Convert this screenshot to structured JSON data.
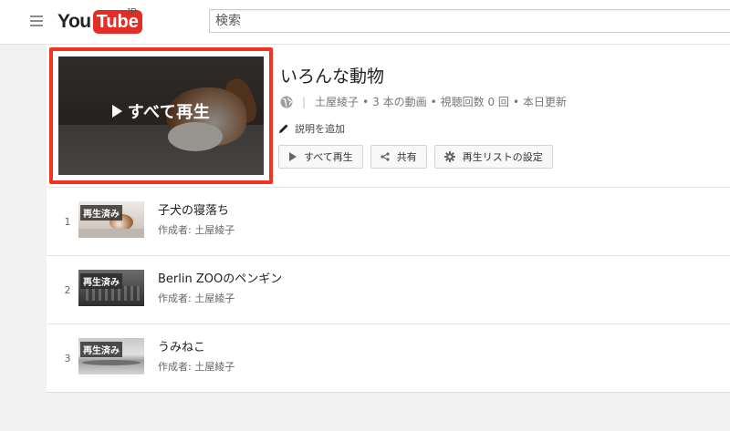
{
  "header": {
    "logo_you": "You",
    "logo_tube": "Tube",
    "logo_region": "JP",
    "search_placeholder": "検索"
  },
  "playlist": {
    "play_all_overlay": "すべて再生",
    "title": "いろんな動物",
    "owner": "土屋綾子",
    "video_count": "3 本の動画",
    "view_count": "視聴回数 0 回",
    "updated": "本日更新",
    "meta_separator": "•",
    "add_description": "説明を追加",
    "buttons": {
      "play_all": "すべて再生",
      "share": "共有",
      "settings": "再生リストの設定"
    }
  },
  "videos": [
    {
      "index": "1",
      "title": "子犬の寝落ち",
      "author": "作成者: 土屋綾子",
      "badge": "再生済み"
    },
    {
      "index": "2",
      "title": "Berlin ZOOのペンギン",
      "author": "作成者: 土屋綾子",
      "badge": "再生済み"
    },
    {
      "index": "3",
      "title": "うみねこ",
      "author": "作成者: 土屋綾子",
      "badge": "再生済み"
    }
  ],
  "colors": {
    "highlight_border": "#f2341e",
    "logo_red": "#e52d27"
  }
}
